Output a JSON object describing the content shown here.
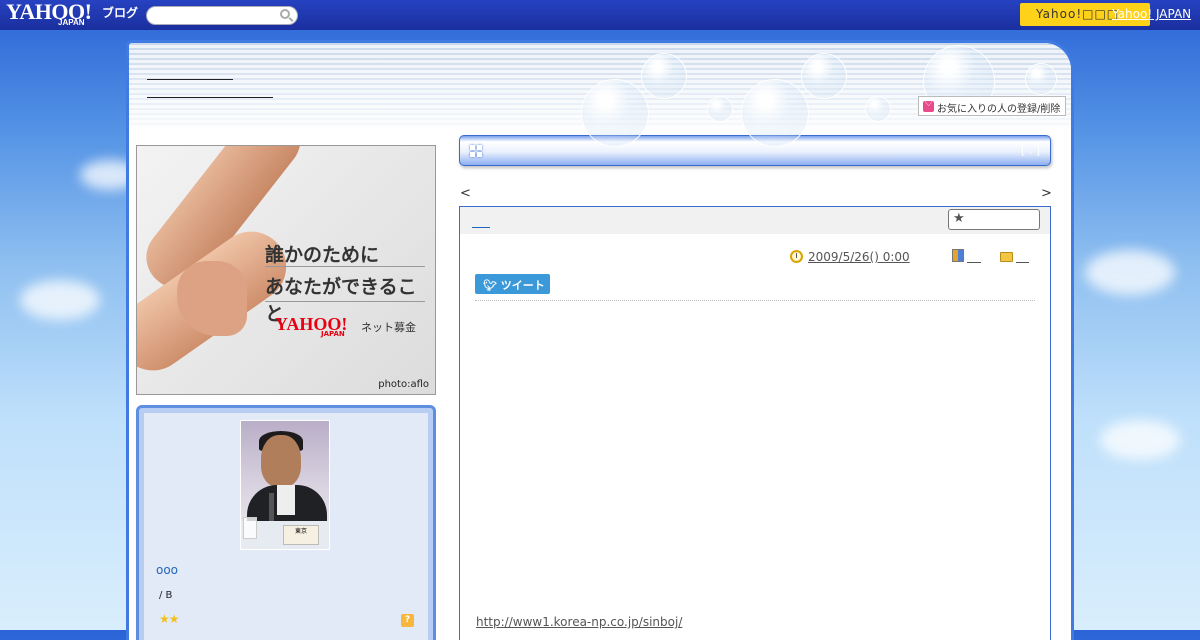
{
  "topbar": {
    "logo": "YAHOO!",
    "logo_sub": "JAPAN",
    "service": "ブログ",
    "search_placeholder": "",
    "yahoo_button": "Yahoo!□□□",
    "yahoo_japan_link": "Yahoo! JAPAN"
  },
  "header": {
    "favorite_button": "お気に入りの人の登録/削除"
  },
  "banner": {
    "line1": "誰かのために",
    "line2": "あなたができること",
    "logo": "YAHOO!",
    "logo_sub": "JAPAN",
    "donation": "ネット募金",
    "credit": "photo:aflo"
  },
  "profile": {
    "nickname": "ooo",
    "sub": "/ B",
    "stars": "★★",
    "help": "?",
    "card": "東京"
  },
  "article_bar": {
    "right_text": "[ . ]"
  },
  "nav": {
    "prev": "<",
    "next": ">"
  },
  "entry": {
    "date": "2009/5/26()  0:00",
    "tweet": "ツイート",
    "link": "http://www1.korea-np.co.jp/sinboj/"
  },
  "colors": {
    "topbar": "#1f3aae",
    "accent_blue": "#3f7be3",
    "yahoo_button": "#ffd21a",
    "tweet": "#3b99d9"
  }
}
